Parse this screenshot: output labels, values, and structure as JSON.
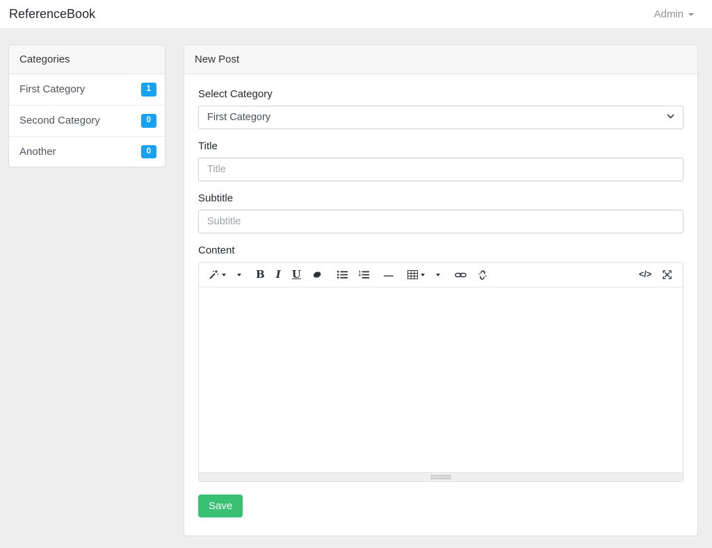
{
  "navbar": {
    "brand": "ReferenceBook",
    "user_menu_label": "Admin"
  },
  "sidebar": {
    "header": "Categories",
    "items": [
      {
        "label": "First Category",
        "count": "1"
      },
      {
        "label": "Second Category",
        "count": "0"
      },
      {
        "label": "Another",
        "count": "0"
      }
    ]
  },
  "main": {
    "header": "New Post",
    "form": {
      "category_label": "Select Category",
      "category_selected": "First Category",
      "title_label": "Title",
      "title_placeholder": "Title",
      "subtitle_label": "Subtitle",
      "subtitle_placeholder": "Subtitle",
      "content_label": "Content"
    },
    "editor": {
      "bold_glyph": "B",
      "italic_glyph": "I",
      "underline_glyph": "U",
      "hr_glyph": "—",
      "codeview_glyph": "</>",
      "icons": [
        "magic-wand",
        "dropdown-caret",
        "bold",
        "italic",
        "underline",
        "eraser",
        "unordered-list",
        "ordered-list",
        "horizontal-rule",
        "table",
        "link",
        "unlink",
        "code-view",
        "fullscreen"
      ]
    },
    "save_label": "Save"
  },
  "colors": {
    "badge_blue": "#18a2f3",
    "save_green": "#38c172",
    "page_background": "#eeeeee",
    "card_header_bg": "#f7f7f7"
  }
}
